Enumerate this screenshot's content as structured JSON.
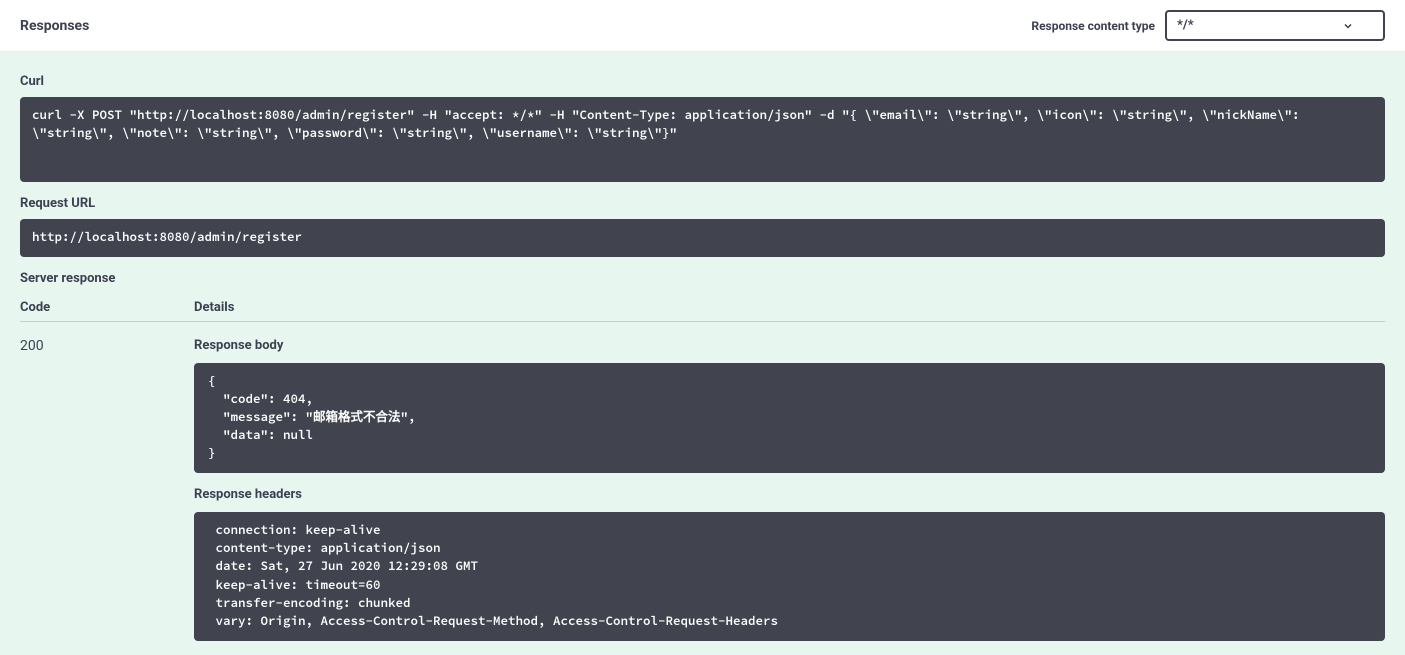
{
  "header": {
    "title": "Responses",
    "content_type_label": "Response content type",
    "content_type_value": "*/*"
  },
  "curl": {
    "label": "Curl",
    "value": "curl -X POST \"http://localhost:8080/admin/register\" -H \"accept: */*\" -H \"Content-Type: application/json\" -d \"{ \\\"email\\\": \\\"string\\\", \\\"icon\\\": \\\"string\\\", \\\"nickName\\\": \\\"string\\\", \\\"note\\\": \\\"string\\\", \\\"password\\\": \\\"string\\\", \\\"username\\\": \\\"string\\\"}\""
  },
  "request_url": {
    "label": "Request URL",
    "value": "http://localhost:8080/admin/register"
  },
  "server_response": {
    "label": "Server response",
    "col_code": "Code",
    "col_details": "Details",
    "code": "200",
    "body_label": "Response body",
    "body_value": "{\n  \"code\": 404,\n  \"message\": \"邮箱格式不合法\",\n  \"data\": null\n}",
    "headers_label": "Response headers",
    "headers_value": " connection: keep-alive \n content-type: application/json \n date: Sat, 27 Jun 2020 12:29:08 GMT \n keep-alive: timeout=60 \n transfer-encoding: chunked \n vary: Origin, Access-Control-Request-Method, Access-Control-Request-Headers "
  }
}
